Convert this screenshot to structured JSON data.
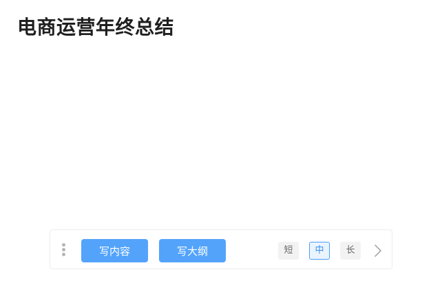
{
  "document": {
    "title": "电商运营年终总结"
  },
  "toolbar": {
    "write_content_label": "写内容",
    "write_outline_label": "写大纲",
    "length_options": [
      {
        "label": "短",
        "selected": false
      },
      {
        "label": "中",
        "selected": true
      },
      {
        "label": "长",
        "selected": false
      }
    ],
    "icons": {
      "drag": "more-vertical-icon",
      "next": "chevron-right-icon"
    }
  },
  "colors": {
    "accent": "#53a3fb",
    "selected_border": "#4a9df8",
    "title_text": "#1f1f1f"
  }
}
